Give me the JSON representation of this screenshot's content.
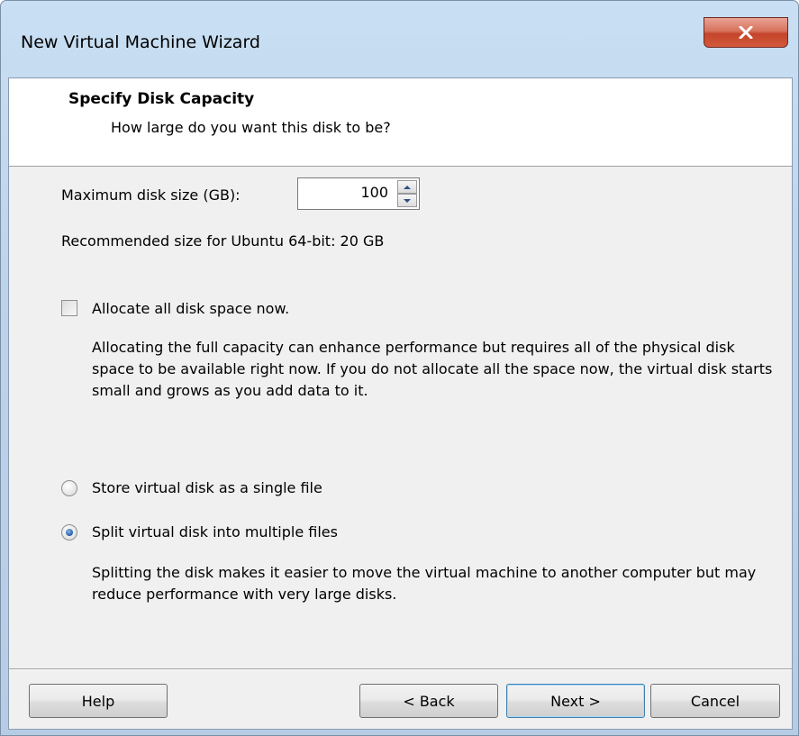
{
  "window": {
    "title": "New Virtual Machine Wizard",
    "close_icon": "close-x-icon"
  },
  "header": {
    "title": "Specify Disk Capacity",
    "subtitle": "How large do you want this disk to be?"
  },
  "disk": {
    "size_label": "Maximum disk size (GB):",
    "size_value": "100",
    "recommended": "Recommended size for Ubuntu 64-bit: 20 GB"
  },
  "allocate": {
    "label": "Allocate all disk space now.",
    "checked": false,
    "description": "Allocating the full capacity can enhance performance but requires all of the physical disk space to be available right now. If you do not allocate all the space now, the virtual disk starts small and grows as you add data to it."
  },
  "storage": {
    "options": [
      {
        "label": "Store virtual disk as a single file",
        "selected": false
      },
      {
        "label": "Split virtual disk into multiple files",
        "selected": true
      }
    ],
    "split_description": "Splitting the disk makes it easier to move the virtual machine to another computer but may reduce performance with very large disks."
  },
  "buttons": {
    "help": "Help",
    "back": "< Back",
    "next": "Next >",
    "cancel": "Cancel"
  },
  "colors": {
    "client_bg": "#f0f0f0",
    "header_bg": "#ffffff",
    "close_button": "#c4442a",
    "default_button_border": "#3c7fb1"
  }
}
